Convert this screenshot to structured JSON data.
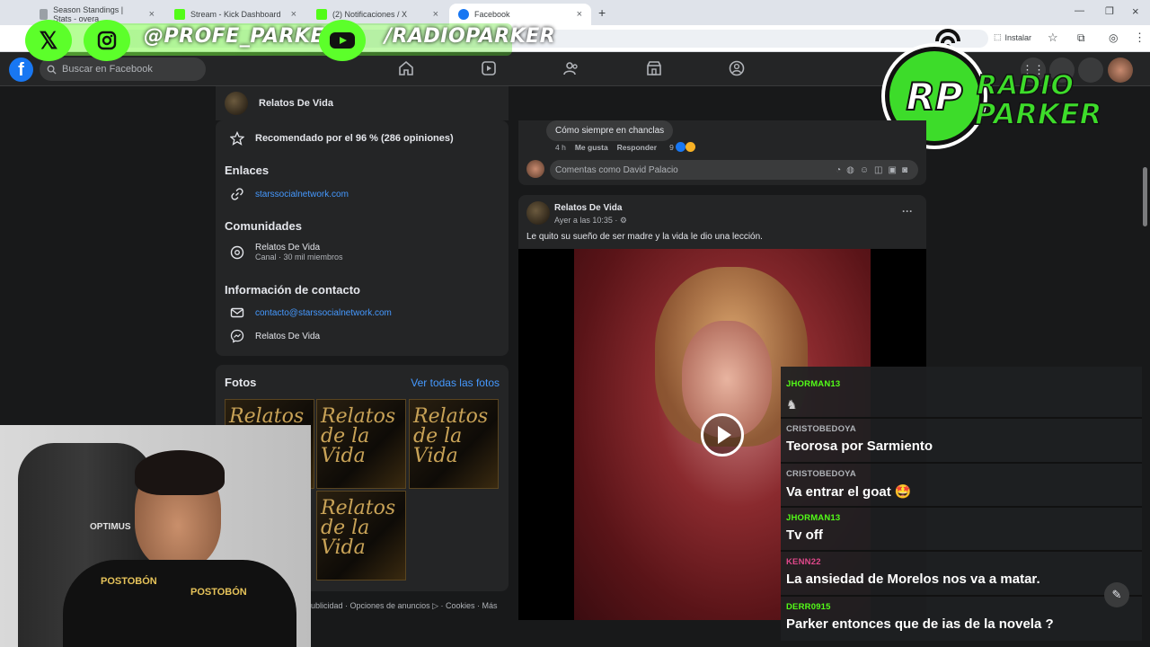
{
  "browser": {
    "tabs": [
      {
        "label": "Season Standings | Stats - overa",
        "color": "#9aa0a6"
      },
      {
        "label": "Stream - Kick Dashboard",
        "color": "#53fc18"
      },
      {
        "label": "(2) Notificaciones / X",
        "color": "#53fc18"
      },
      {
        "label": "Facebook",
        "color": "#1877f2"
      }
    ],
    "new_tab": "+",
    "install_label": "Instalar"
  },
  "overlay": {
    "x_handle": "@PROFE_PARKER",
    "yt_handle": "/RADIOPARKER",
    "logo_line1": "RADIO",
    "logo_line2": "PARKER",
    "logo_mark": "RP"
  },
  "facebook": {
    "search_placeholder": "Buscar en Facebook",
    "page_name": "Relatos De Vida",
    "recommended": "Recomendado por el 96 % (286 opiniones)",
    "links_heading": "Enlaces",
    "website": "starssocialnetwork.com",
    "communities_heading": "Comunidades",
    "community_name": "Relatos De Vida",
    "community_sub": "Canal · 30 mil miembros",
    "contact_heading": "Información de contacto",
    "email": "contacto@starssocialnetwork.com",
    "messenger": "Relatos De Vida",
    "photos_heading": "Fotos",
    "see_all_photos": "Ver todas las fotos",
    "photo_text": "Relatos de la Vida",
    "footer": "ublicidad · Opciones de anuncios ▷ · Cookies · Más"
  },
  "feed": {
    "comment_text": "Cómo siempre en chanclas",
    "comment_time": "4 h",
    "like_label": "Me gusta",
    "reply_label": "Responder",
    "reaction_count": "9",
    "comment_placeholder": "Comentas como David Palacio",
    "post_author": "Relatos De Vida",
    "post_time": "Ayer a las 10:35 · ⚙",
    "post_text": "Le quito su sueño de ser madre y la vida le dio una lección.",
    "more": "···"
  },
  "chat": {
    "messages": [
      {
        "user": "JHORMAN13",
        "text": "",
        "color": "#53fc18"
      },
      {
        "user": "CRISTOBEDOYA",
        "text": "Teorosa por Sarmiento",
        "color": "#b0b3b8"
      },
      {
        "user": "CRISTOBEDOYA",
        "text": "Va entrar el goat 🤩",
        "color": "#b0b3b8"
      },
      {
        "user": "JHORMAN13",
        "text": "Tv off",
        "color": "#53fc18"
      },
      {
        "user": "KENN22",
        "text": "La ansiedad de Morelos nos va a matar.",
        "color": "#e0488b"
      },
      {
        "user": "DERR0915",
        "text": "Parker entonces que de ias de la novela ?",
        "color": "#53fc18"
      }
    ]
  },
  "webcam": {
    "shirt_brand": "POSTOBÓN",
    "chair_brand": "OPTIMUS"
  }
}
